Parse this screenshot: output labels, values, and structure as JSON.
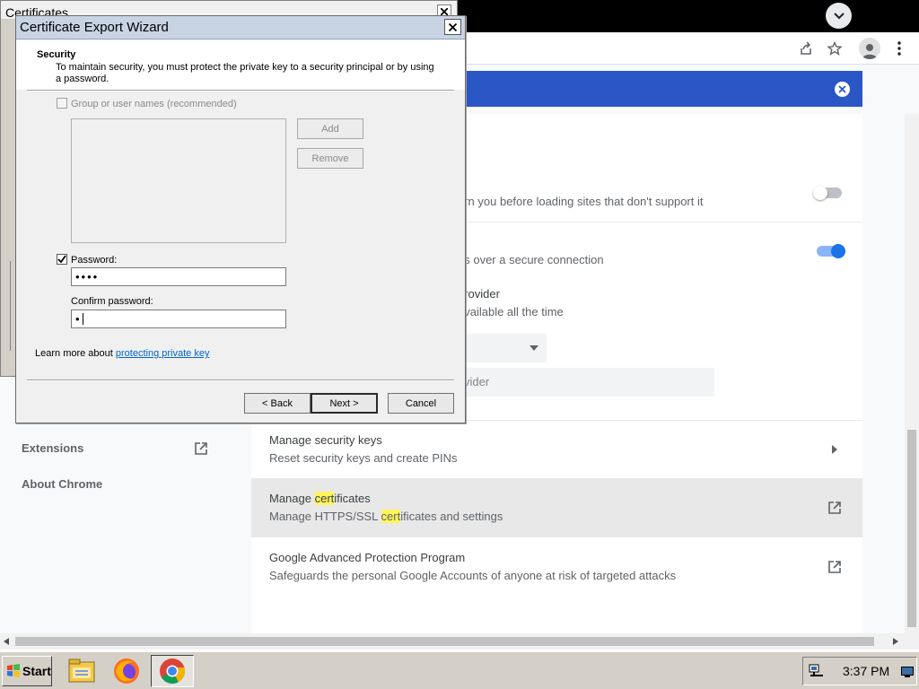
{
  "browser": {
    "page": {
      "sidebar": {
        "extensions": "Extensions",
        "about": "About Chrome"
      },
      "rows": {
        "https_warn_text": "arn you before loading sites that don't support it",
        "secure_dns_text": "es over a secure connection",
        "provider_title": " provider",
        "provider_desc": "available all the time",
        "provider_input_text": "vider",
        "security_keys": {
          "title": "Manage security keys",
          "desc": "Reset security keys and create PINs"
        },
        "certificates": {
          "title_pre": "Manage ",
          "title_hl": "cert",
          "title_post": "ificates",
          "desc_pre": "Manage HTTPS/SSL ",
          "desc_hl": "cert",
          "desc_post": "ificates and settings"
        },
        "advanced_protection": {
          "title": "Google Advanced Protection Program",
          "desc": "Safeguards the personal Google Accounts of anyone at risk of targeted attacks"
        }
      }
    }
  },
  "mmc": {
    "title": "Certificates"
  },
  "wizard": {
    "title": "Certificate Export Wizard",
    "heading": "Security",
    "description": "To maintain security, you must protect the private key to a security principal or by using a password.",
    "group_checkbox_label": "Group or user names (recommended)",
    "add_label": "Add",
    "remove_label": "Remove",
    "password_label": "Password:",
    "password_value": "••••",
    "confirm_label": "Confirm password:",
    "confirm_value": "•",
    "learn_more_text": "Learn more about ",
    "learn_more_link": "protecting private key",
    "back_label": "< Back",
    "next_label": "Next >",
    "cancel_label": "Cancel"
  },
  "taskbar": {
    "start_label": "Start",
    "clock": "3:37 PM"
  },
  "colors": {
    "search_bar": "#2a56c6",
    "toggle_on": "#1a73e8",
    "highlight": "#fef55a",
    "wizard_title": "#c8d3e4"
  },
  "icons": {
    "chrome_menu": "chevron-down-icon",
    "share": "share-icon",
    "bookmark": "star-icon",
    "profile": "profile-icon",
    "kebab": "more-vert-icon",
    "search_clear": "close-icon",
    "external_link": "open-in-new-icon",
    "row_arrow": "chevron-right-icon"
  }
}
